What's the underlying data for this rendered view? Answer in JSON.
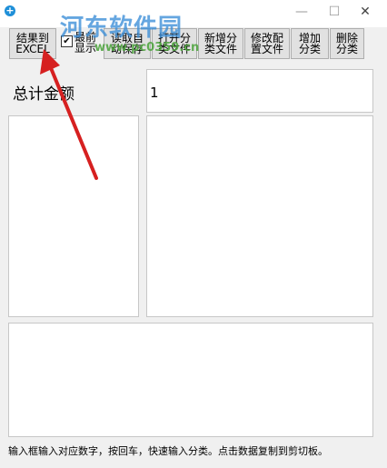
{
  "watermark": {
    "site": "河东软件园",
    "url": "www.pc0359.cn"
  },
  "window": {
    "minimize": "—",
    "maximize": "☐",
    "close": "✕",
    "app_icon": "+"
  },
  "toolbar": {
    "export_btn": "结果到\nEXCEL",
    "front_check": "最前\n显示",
    "read_save_btn": "读取自\n动保存",
    "open_class_btn": "打开分\n类文件",
    "new_class_btn": "新增分\n类文件",
    "modify_config_btn": "修改配\n置文件",
    "add_class_btn": "增加\n分类",
    "delete_class_btn": "删除\n分类"
  },
  "summary": {
    "label": "总计金额",
    "value": "1"
  },
  "status": {
    "text": "输入框输入对应数字，按回车，快速输入分类。点击数据复制到剪切板。"
  },
  "colors": {
    "arrow": "#d62020",
    "accent": "#1e8fd8"
  }
}
